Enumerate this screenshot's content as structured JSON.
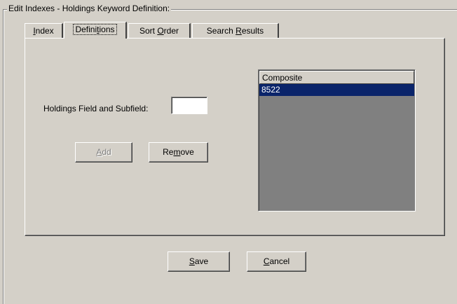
{
  "groupbox": {
    "title": "Edit  Indexes - Holdings Keyword Definition:"
  },
  "tabs": [
    {
      "pre": "",
      "acc": "I",
      "post": "ndex"
    },
    {
      "pre": "Defini",
      "acc": "t",
      "post": "ions"
    },
    {
      "pre": "Sort ",
      "acc": "O",
      "post": "rder"
    },
    {
      "pre": "Search ",
      "acc": "R",
      "post": "esults"
    }
  ],
  "active_tab": "Definitions",
  "form": {
    "field_label": "Holdings Field and Subfield:",
    "field_value": ""
  },
  "buttons": {
    "add": {
      "pre": "",
      "acc": "A",
      "post": "dd",
      "enabled": false
    },
    "remove": {
      "pre": "Re",
      "acc": "m",
      "post": "ove",
      "enabled": true
    },
    "save": {
      "pre": "",
      "acc": "S",
      "post": "ave"
    },
    "cancel": {
      "pre": "",
      "acc": "C",
      "post": "ancel"
    }
  },
  "list": {
    "header": "Composite",
    "items": [
      "8522"
    ],
    "selected_index": 0
  },
  "colors": {
    "window_bg": "#d4d0c8",
    "selection_bg": "#0a246a",
    "list_bg": "#808080"
  }
}
